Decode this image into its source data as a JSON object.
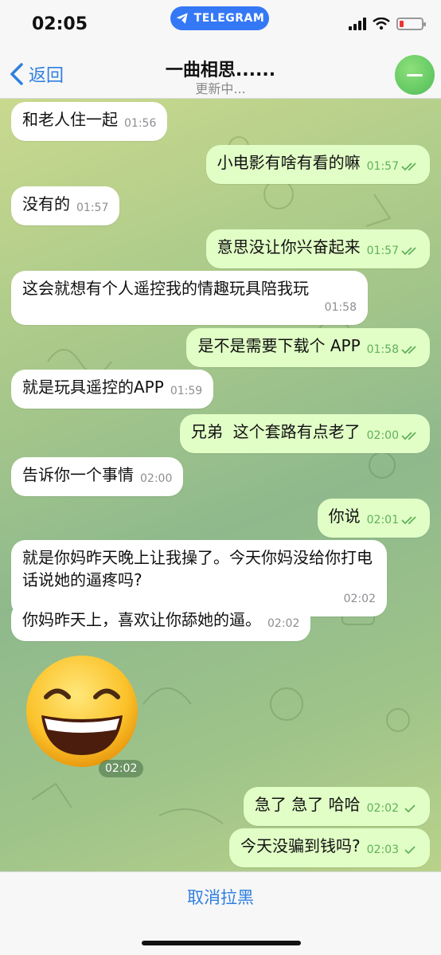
{
  "status_bar": {
    "time": "02:05",
    "app_badge": "TELEGRAM"
  },
  "header": {
    "back_label": "返回",
    "title": "一曲相思......",
    "subtitle": "更新中..."
  },
  "colors": {
    "accent": "#2f7fe0",
    "outgoing_bubble": "#e1fec6",
    "incoming_bubble": "#ffffff",
    "avatar": "#4fbd58"
  },
  "messages": [
    {
      "dir": "in",
      "text": "和老人住一起",
      "time": "01:56"
    },
    {
      "dir": "out",
      "text": "小电影有啥有看的嘛",
      "time": "01:57"
    },
    {
      "dir": "in",
      "text": "没有的",
      "time": "01:57"
    },
    {
      "dir": "out",
      "text": "意思没让你兴奋起来",
      "time": "01:57"
    },
    {
      "dir": "in",
      "text": "这会就想有个人遥控我的情趣玩具陪我玩",
      "time": "01:58"
    },
    {
      "dir": "out",
      "text": "是不是需要下载个 APP",
      "time": "01:58"
    },
    {
      "dir": "in",
      "text": "就是玩具遥控的APP",
      "time": "01:59"
    },
    {
      "dir": "out",
      "text": "兄弟  这个套路有点老了",
      "time": "02:00"
    },
    {
      "dir": "in",
      "text": "告诉你一个事情",
      "time": "02:00"
    },
    {
      "dir": "out",
      "text": "你说",
      "time": "02:01"
    },
    {
      "dir": "in",
      "text": "就是你妈昨天晚上让我操了。今天你妈没给你打电话说她的逼疼吗?",
      "time": "02:02"
    },
    {
      "dir": "in",
      "text": "你妈昨天上，喜欢让你舔她的逼。",
      "time": "02:02"
    },
    {
      "dir": "in",
      "type": "sticker",
      "sticker": "grinning-face",
      "time": "02:02"
    },
    {
      "dir": "out",
      "text": "急了 急了 哈哈",
      "time": "02:02"
    },
    {
      "dir": "out",
      "text": "今天没骗到钱吗?",
      "time": "02:03"
    }
  ],
  "bottom": {
    "action_label": "取消拉黑"
  }
}
